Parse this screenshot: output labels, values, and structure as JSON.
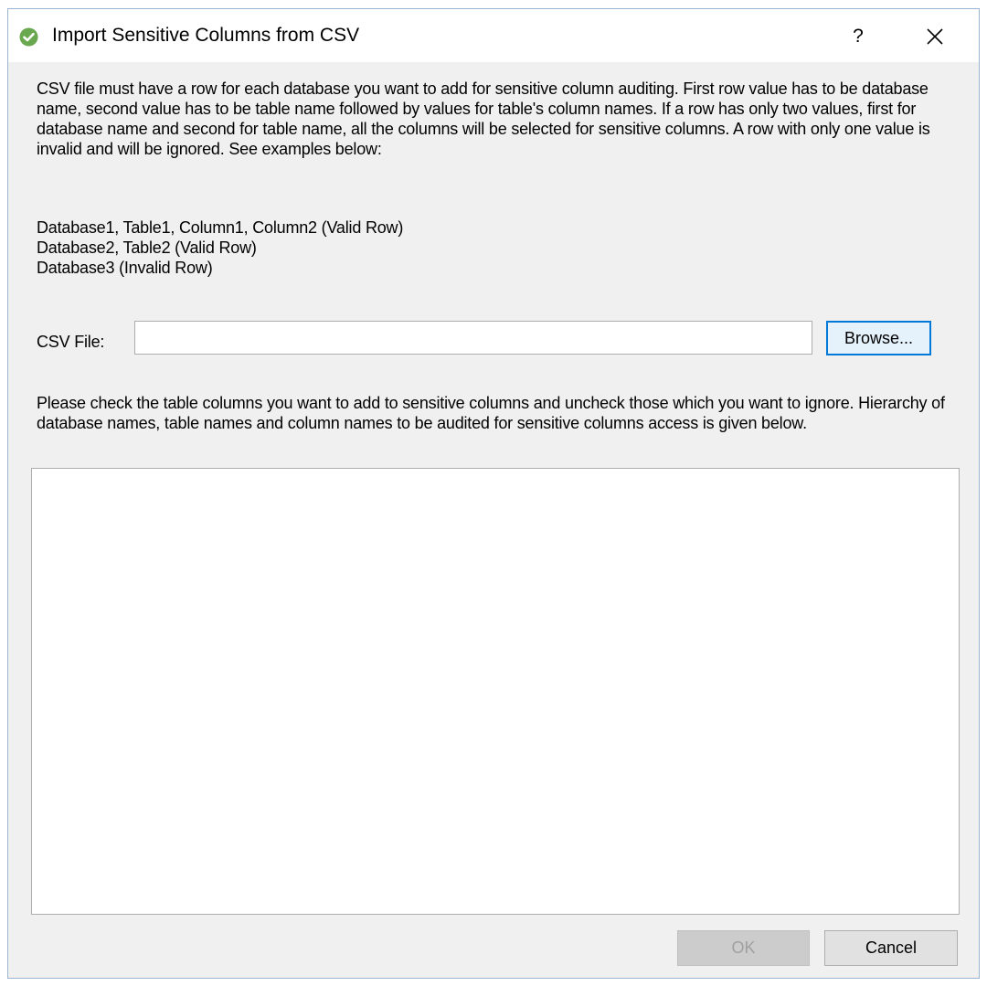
{
  "window": {
    "title": "Import Sensitive Columns from CSV",
    "icon": "check-circle-icon",
    "help_label": "?",
    "close_icon": "close-icon",
    "accent_color": "#0078d7",
    "icon_color": "#6aa84f"
  },
  "intro": {
    "text": "CSV file must have a row for each database you want to add for sensitive column auditing. First row value has to be database name, second value has to be table name followed by values for table's column names. If a row has only two values, first for database name and second for table name, all the columns will be selected for sensitive columns. A row with only one value is invalid and will be ignored. See examples below:"
  },
  "examples": [
    "Database1, Table1, Column1, Column2 (Valid Row)",
    "Database2, Table2 (Valid Row)",
    "Database3 (Invalid Row)"
  ],
  "csv_file": {
    "label": "CSV File:",
    "value": "",
    "browse_label": "Browse..."
  },
  "instructions": {
    "text": "Please check the table columns you want to add to sensitive columns and uncheck those which you want to ignore. Hierarchy of database names, table names and column names to be audited for sensitive columns access is given below."
  },
  "buttons": {
    "ok_label": "OK",
    "ok_enabled": false,
    "cancel_label": "Cancel"
  }
}
